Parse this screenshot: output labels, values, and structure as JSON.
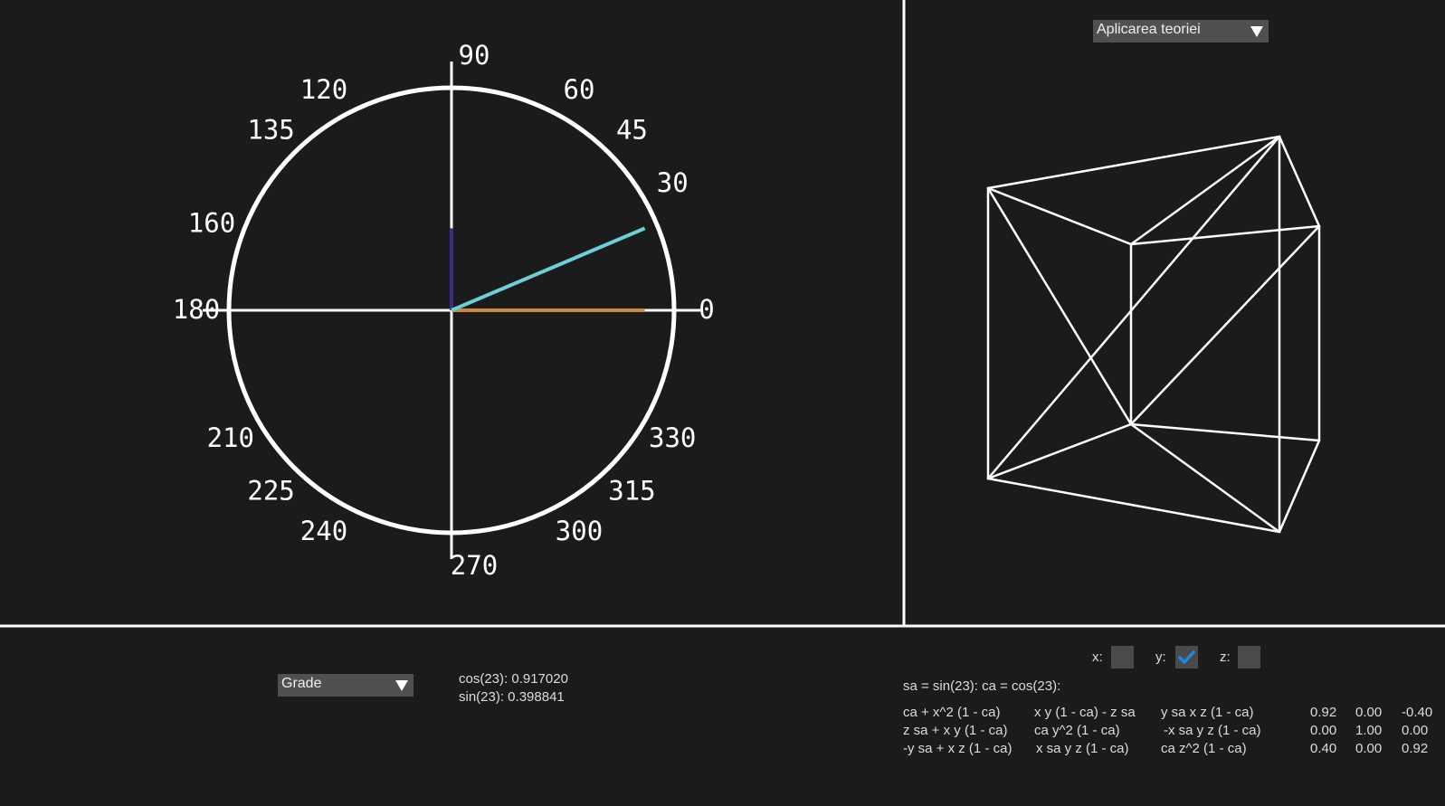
{
  "circle": {
    "angle_labels": [
      "0",
      "30",
      "45",
      "60",
      "90",
      "120",
      "135",
      "160",
      "180",
      "210",
      "225",
      "240",
      "270",
      "300",
      "315",
      "330"
    ],
    "selected_angle_deg": 23,
    "colors": {
      "radius": "#6ccfd8",
      "cos": "#c98a3b",
      "sin": "#3b2a8c",
      "lines": "#ffffff"
    }
  },
  "unit_select": {
    "value": "Grade"
  },
  "readout": {
    "cos": "cos(23): 0.917020",
    "sin": "sin(23): 0.398841"
  },
  "theory_select": {
    "value": "Aplicarea teoriei"
  },
  "axes": {
    "x": {
      "label": "x:",
      "checked": false
    },
    "y": {
      "label": "y:",
      "checked": true
    },
    "z": {
      "label": "z:",
      "checked": false
    }
  },
  "formula_header": "sa = sin(23):   ca = cos(23):",
  "matrix_formulas": [
    [
      "ca + x^2 (1 - ca)",
      "x y (1 - ca) - z sa",
      "y sa x z (1 - ca)"
    ],
    [
      "z sa + x y (1 - ca)",
      "ca y^2 (1 - ca)",
      "-x sa y z (1 - ca)"
    ],
    [
      "-y sa + x z (1 - ca)",
      "x sa y z (1 - ca)",
      "ca z^2 (1 - ca)"
    ]
  ],
  "matrix_values": [
    [
      "0.92",
      "0.00",
      "-0.40"
    ],
    [
      "0.00",
      "1.00",
      "0.00"
    ],
    [
      "0.40",
      "0.00",
      "0.92"
    ]
  ],
  "colors": {
    "background": "#1b1b1b",
    "control": "#505050",
    "check": "#1e88e5"
  }
}
